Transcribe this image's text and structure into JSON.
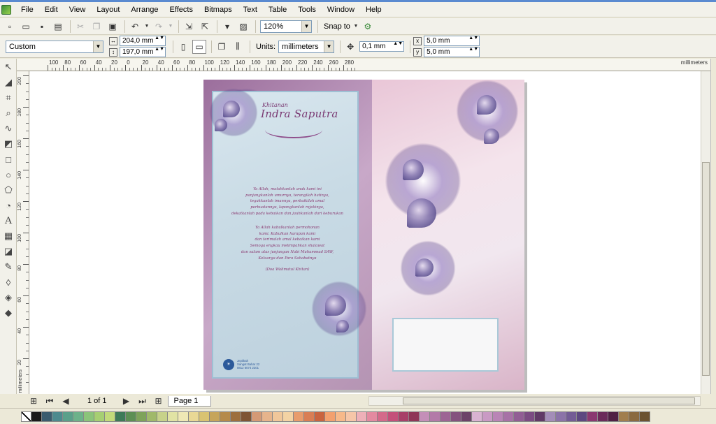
{
  "menu": {
    "items": [
      "File",
      "Edit",
      "View",
      "Layout",
      "Arrange",
      "Effects",
      "Bitmaps",
      "Text",
      "Table",
      "Tools",
      "Window",
      "Help"
    ]
  },
  "toolbar": {
    "zoom": "120%",
    "snap_label": "Snap to"
  },
  "property_bar": {
    "page_preset": "Custom",
    "width": "204,0 mm",
    "height": "197,0 mm",
    "units_label": "Units:",
    "units": "millimeters",
    "nudge": "0,1 mm",
    "dup_x": "5,0 mm",
    "dup_y": "5,0 mm"
  },
  "ruler": {
    "unit_label": "millimeters",
    "h_ticks": [
      "100",
      "80",
      "60",
      "40",
      "20",
      "0",
      "20",
      "40",
      "60",
      "80",
      "100",
      "120",
      "140",
      "160",
      "180",
      "200",
      "220",
      "240",
      "260",
      "280"
    ],
    "v_ticks": [
      "200",
      "180",
      "160",
      "140",
      "120",
      "100",
      "80",
      "60",
      "40",
      "20"
    ]
  },
  "page_nav": {
    "counter": "1 of 1",
    "tab": "Page 1"
  },
  "design": {
    "title_small": "Khitanan",
    "title_name": "Indra Saputra",
    "poem_1": [
      "Ya Allah, matahkanlah anak kami ini",
      "panjangkanlah umurnya, terangilah hatinya,",
      "tegakkanlah imannya, perbaikilah amal",
      "perbuatannya, lapangkanlah rejekinya,",
      "dekatkanlah pada kebaikan dan jauhkanlah dari keburukan"
    ],
    "poem_2": [
      "Ya Allah kabulkanlah permohonan",
      "kami. Kabulkan harapan kami",
      "dan terimalah amal kebaikan kami",
      "Semoga engkau melimpahkan shalawat",
      "dan salam atas junjungan Nabi Muhammad SAW,",
      "Keluarga dan Para Sahabatnya"
    ],
    "signature": "(Doa Walimatul Khitan)",
    "logo_text": [
      "Jepitkah",
      "Sangat Bahar 22",
      "0812 6074 2201"
    ]
  },
  "palette": [
    "#1a1a1a",
    "#3b5c6e",
    "#4d8a8e",
    "#5aa08a",
    "#6db28a",
    "#8bc47a",
    "#a6cf72",
    "#c2da7a",
    "#3e7a58",
    "#5d8f54",
    "#7ea35a",
    "#a0b96a",
    "#c7d28a",
    "#e1e3a4",
    "#efe8b5",
    "#e9d895",
    "#d9c372",
    "#c6a55a",
    "#b58a4a",
    "#9d6f3e",
    "#7f5534",
    "#d49a76",
    "#e6b48c",
    "#f0c79a",
    "#f3d3a4",
    "#e89c6c",
    "#d97e54",
    "#c9643f",
    "#f3a06e",
    "#f7b98a",
    "#f6c6a8",
    "#eeb0b8",
    "#e38aa0",
    "#d46a8a",
    "#c4507a",
    "#a84068",
    "#8f3656",
    "#c48fb8",
    "#b37aa8",
    "#9d6594",
    "#84527e",
    "#6c4268",
    "#d9b3d2",
    "#c99ac4",
    "#b985b6",
    "#a772a6",
    "#915e94",
    "#7b4c82",
    "#603a66",
    "#a38db8",
    "#8b73a8",
    "#735c95",
    "#5d4880",
    "#8a3870",
    "#6b2b5a",
    "#4f2044",
    "#a17e4e",
    "#8a6a40",
    "#6b5230"
  ]
}
